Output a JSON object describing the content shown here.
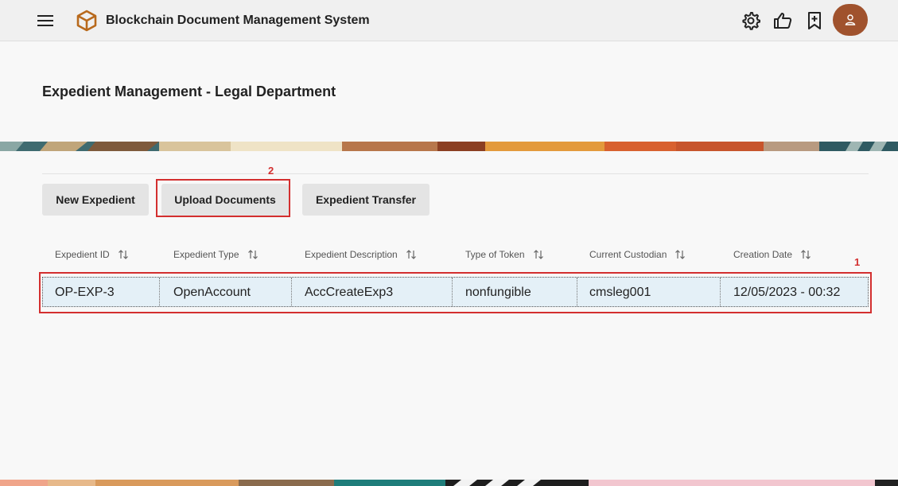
{
  "header": {
    "title": "Blockchain Document Management System",
    "icons": [
      "menu-icon",
      "cube-logo-icon",
      "settings-gear-icon",
      "thumbs-up-icon",
      "bookmark-add-icon",
      "user-avatar-icon"
    ]
  },
  "page": {
    "title": "Expedient Management - Legal Department"
  },
  "actions": {
    "new_expedient": "New Expedient",
    "upload_documents": "Upload Documents",
    "expedient_transfer": "Expedient Transfer"
  },
  "table": {
    "columns": [
      "Expedient ID",
      "Expedient Type",
      "Expedient Description",
      "Type of Token",
      "Current Custodian",
      "Creation Date"
    ],
    "rows": [
      [
        "OP-EXP-3",
        "OpenAccount",
        "AccCreateExp3",
        "nonfungible",
        "cmsleg001",
        "12/05/2023 - 00:32"
      ]
    ]
  },
  "markers": {
    "table_row": "1",
    "upload_button": "2"
  },
  "colors": {
    "accent": "#d32f2f",
    "avatar": "#a0522d",
    "row_highlight": "#e4f0f7",
    "logo": "#b8691c"
  }
}
